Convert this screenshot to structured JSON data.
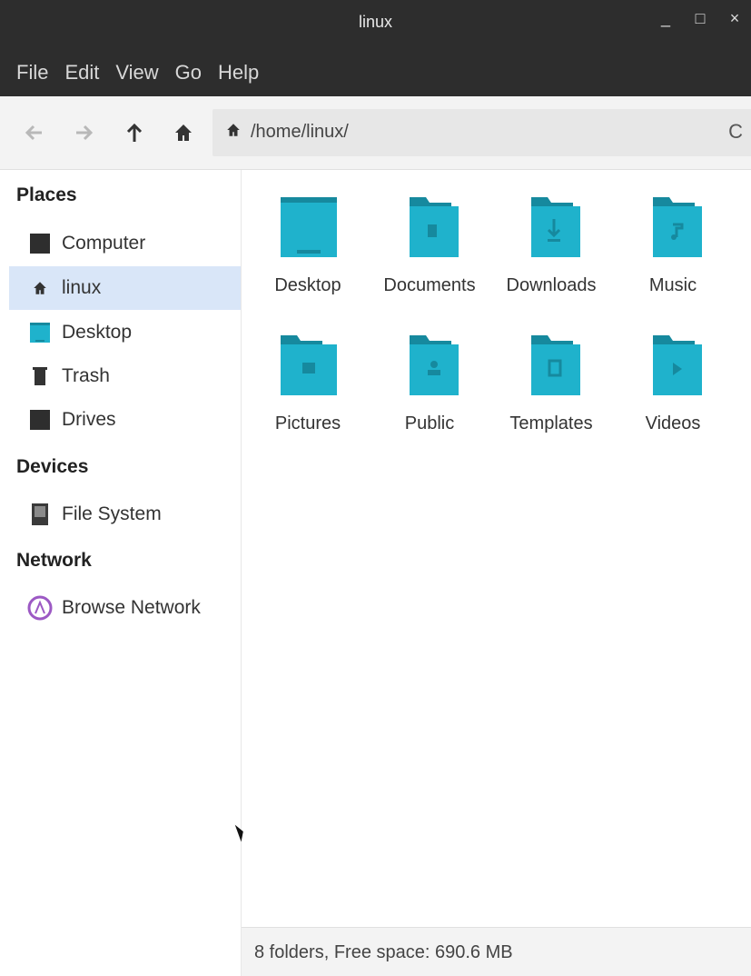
{
  "window": {
    "title": "linux"
  },
  "window_controls": {
    "minimize": "_",
    "maximize": "□",
    "close": "×"
  },
  "menu": [
    "File",
    "Edit",
    "View",
    "Go",
    "Help"
  ],
  "toolbar": {
    "back_icon": "arrow-left-icon",
    "forward_icon": "arrow-right-icon",
    "up_icon": "arrow-up-icon",
    "home_icon": "home-icon",
    "location_path": "/home/linux/",
    "reload_label": "C"
  },
  "sidebar": {
    "sections": [
      {
        "title": "Places",
        "items": [
          {
            "label": "Computer",
            "icon": "computer-icon"
          },
          {
            "label": "linux",
            "icon": "home-icon",
            "active": true
          },
          {
            "label": "Desktop",
            "icon": "desktop-folder-icon"
          },
          {
            "label": "Trash",
            "icon": "trash-icon"
          },
          {
            "label": "Drives",
            "icon": "drives-icon"
          }
        ]
      },
      {
        "title": "Devices",
        "items": [
          {
            "label": "File System",
            "icon": "harddisk-icon"
          }
        ]
      },
      {
        "title": "Network",
        "items": [
          {
            "label": "Browse Network",
            "icon": "network-icon"
          }
        ]
      }
    ]
  },
  "files": [
    {
      "name": "Desktop",
      "icon": "desktop-folder-icon"
    },
    {
      "name": "Documents",
      "icon": "documents-folder-icon"
    },
    {
      "name": "Downloads",
      "icon": "downloads-folder-icon"
    },
    {
      "name": "Music",
      "icon": "music-folder-icon"
    },
    {
      "name": "Pictures",
      "icon": "pictures-folder-icon"
    },
    {
      "name": "Public",
      "icon": "public-folder-icon"
    },
    {
      "name": "Templates",
      "icon": "templates-folder-icon"
    },
    {
      "name": "Videos",
      "icon": "videos-folder-icon"
    }
  ],
  "status": {
    "text": "8 folders, Free space: 690.6 MB"
  },
  "colors": {
    "folder": "#1fb2cc",
    "folder_dark": "#16899e",
    "selection": "#d9e6f8",
    "titlebar": "#2d2d2d"
  }
}
